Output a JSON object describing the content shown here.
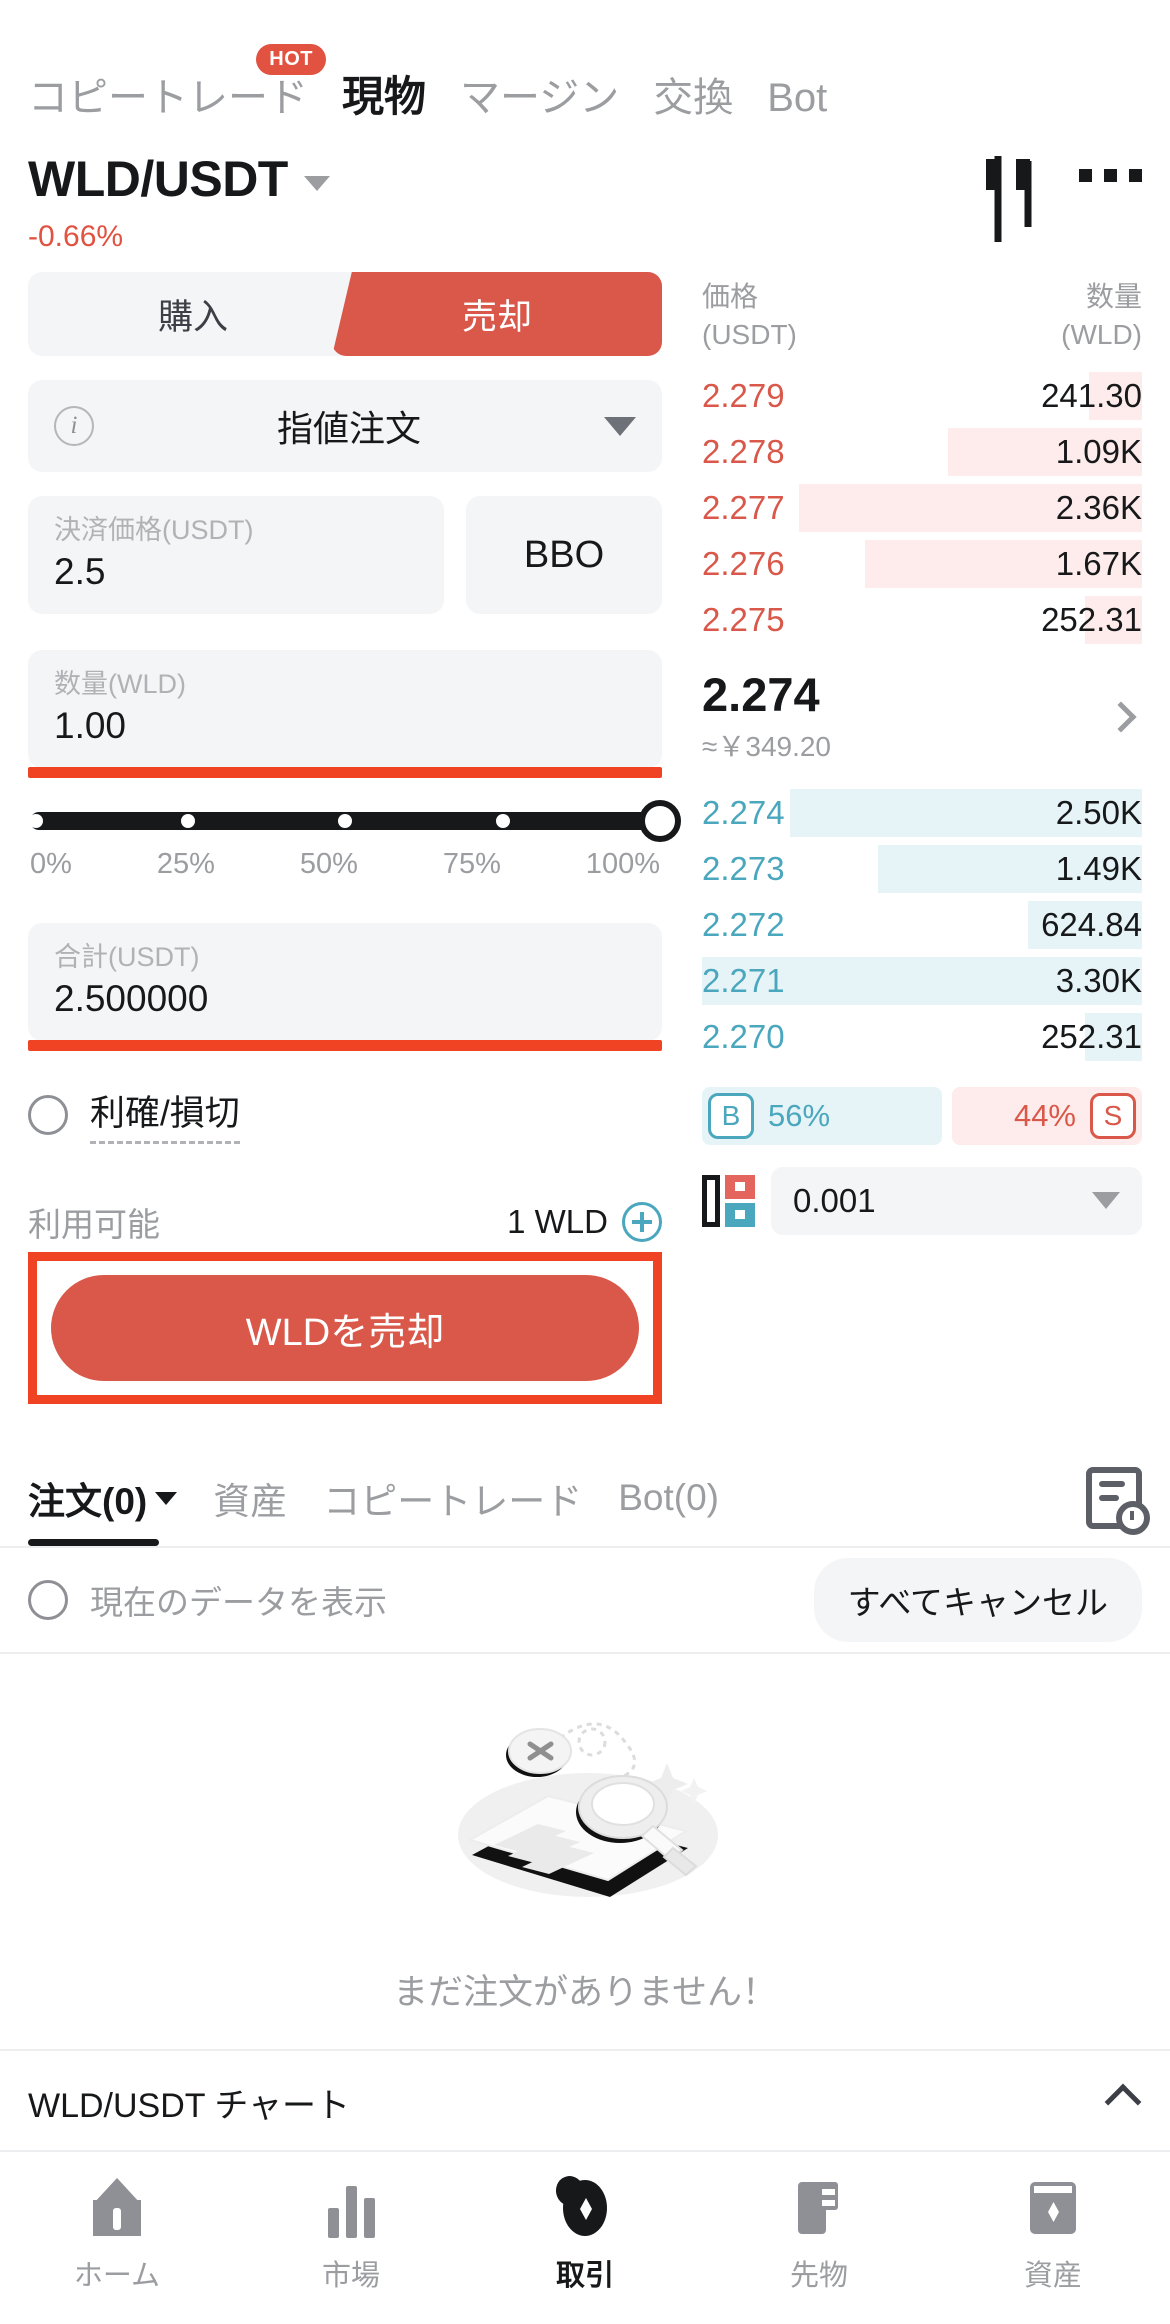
{
  "header": {
    "tabs": [
      {
        "label": "コピートレード",
        "active": false,
        "badge": "HOT"
      },
      {
        "label": "現物",
        "active": true
      },
      {
        "label": "マージン",
        "active": false
      },
      {
        "label": "交換",
        "active": false
      },
      {
        "label": "Bot",
        "active": false
      }
    ],
    "symbol": "WLD/USDT",
    "change": "-0.66%",
    "change_color": "#e15241",
    "chart_icon": "candlestick-icon",
    "more_icon": "more-dots-icon"
  },
  "order_form": {
    "side_buy": "購入",
    "side_sell": "売却",
    "active_side": "sell",
    "order_type": "指値注文",
    "price_label": "決済価格(USDT)",
    "price_value": "2.5",
    "bbo_label": "BBO",
    "amount_label": "数量(WLD)",
    "amount_value": "1.00",
    "slider_percent": 100,
    "slider_ticks": [
      "0%",
      "25%",
      "50%",
      "75%",
      "100%"
    ],
    "total_label": "合計(USDT)",
    "total_value": "2.500000",
    "tpsl_label": "利確/損切",
    "tpsl_checked": false,
    "available_label": "利用可能",
    "available_value": "1 WLD",
    "deposit_icon": "plus-circle-icon",
    "submit_label": "WLDを売却",
    "accent_red": "#d9584a",
    "highlight_red": "#ef4323"
  },
  "order_book": {
    "col_price": "価格",
    "col_price_unit": "(USDT)",
    "col_qty": "数量",
    "col_qty_unit": "(WLD)",
    "asks": [
      {
        "price": "2.279",
        "qty": "241.30",
        "depth": 12
      },
      {
        "price": "2.278",
        "qty": "1.09K",
        "depth": 44
      },
      {
        "price": "2.277",
        "qty": "2.36K",
        "depth": 78
      },
      {
        "price": "2.276",
        "qty": "1.67K",
        "depth": 63
      },
      {
        "price": "2.275",
        "qty": "252.31",
        "depth": 13
      }
    ],
    "mid_price": "2.274",
    "mid_sub": "≈￥349.20",
    "bids": [
      {
        "price": "2.274",
        "qty": "2.50K",
        "depth": 80
      },
      {
        "price": "2.273",
        "qty": "1.49K",
        "depth": 60
      },
      {
        "price": "2.272",
        "qty": "624.84",
        "depth": 26
      },
      {
        "price": "2.271",
        "qty": "3.30K",
        "depth": 100
      },
      {
        "price": "2.270",
        "qty": "252.31",
        "depth": 13
      }
    ],
    "ratio_buy_tag": "B",
    "ratio_buy_pct": "56%",
    "ratio_sell_pct": "44%",
    "ratio_sell_tag": "S",
    "tick_size": "0.001",
    "depth_icon": "orderbook-depth-icon",
    "buy_color": "#4aa7bd",
    "sell_color": "#d9584a"
  },
  "lower_panel": {
    "tabs": [
      {
        "label": "注文(0)",
        "active": true,
        "has_caret": true
      },
      {
        "label": "資産",
        "active": false
      },
      {
        "label": "コピートレード",
        "active": false
      },
      {
        "label": "Bot(0)",
        "active": false
      }
    ],
    "history_icon": "order-history-icon",
    "filter_label": "現在のデータを表示",
    "filter_checked": false,
    "cancel_all_label": "すべてキャンセル",
    "empty_text": "まだ注文がありません！",
    "empty_illustration": "empty-orders-illustration"
  },
  "chart_bar": {
    "label": "WLD/USDT チャート",
    "collapse_icon": "chevron-up-icon"
  },
  "bottom_nav": [
    {
      "label": "ホーム",
      "icon": "home-icon",
      "active": false
    },
    {
      "label": "市場",
      "icon": "market-bars-icon",
      "active": false
    },
    {
      "label": "取引",
      "icon": "trade-icon",
      "active": true
    },
    {
      "label": "先物",
      "icon": "futures-icon",
      "active": false
    },
    {
      "label": "資産",
      "icon": "assets-icon",
      "active": false
    }
  ]
}
